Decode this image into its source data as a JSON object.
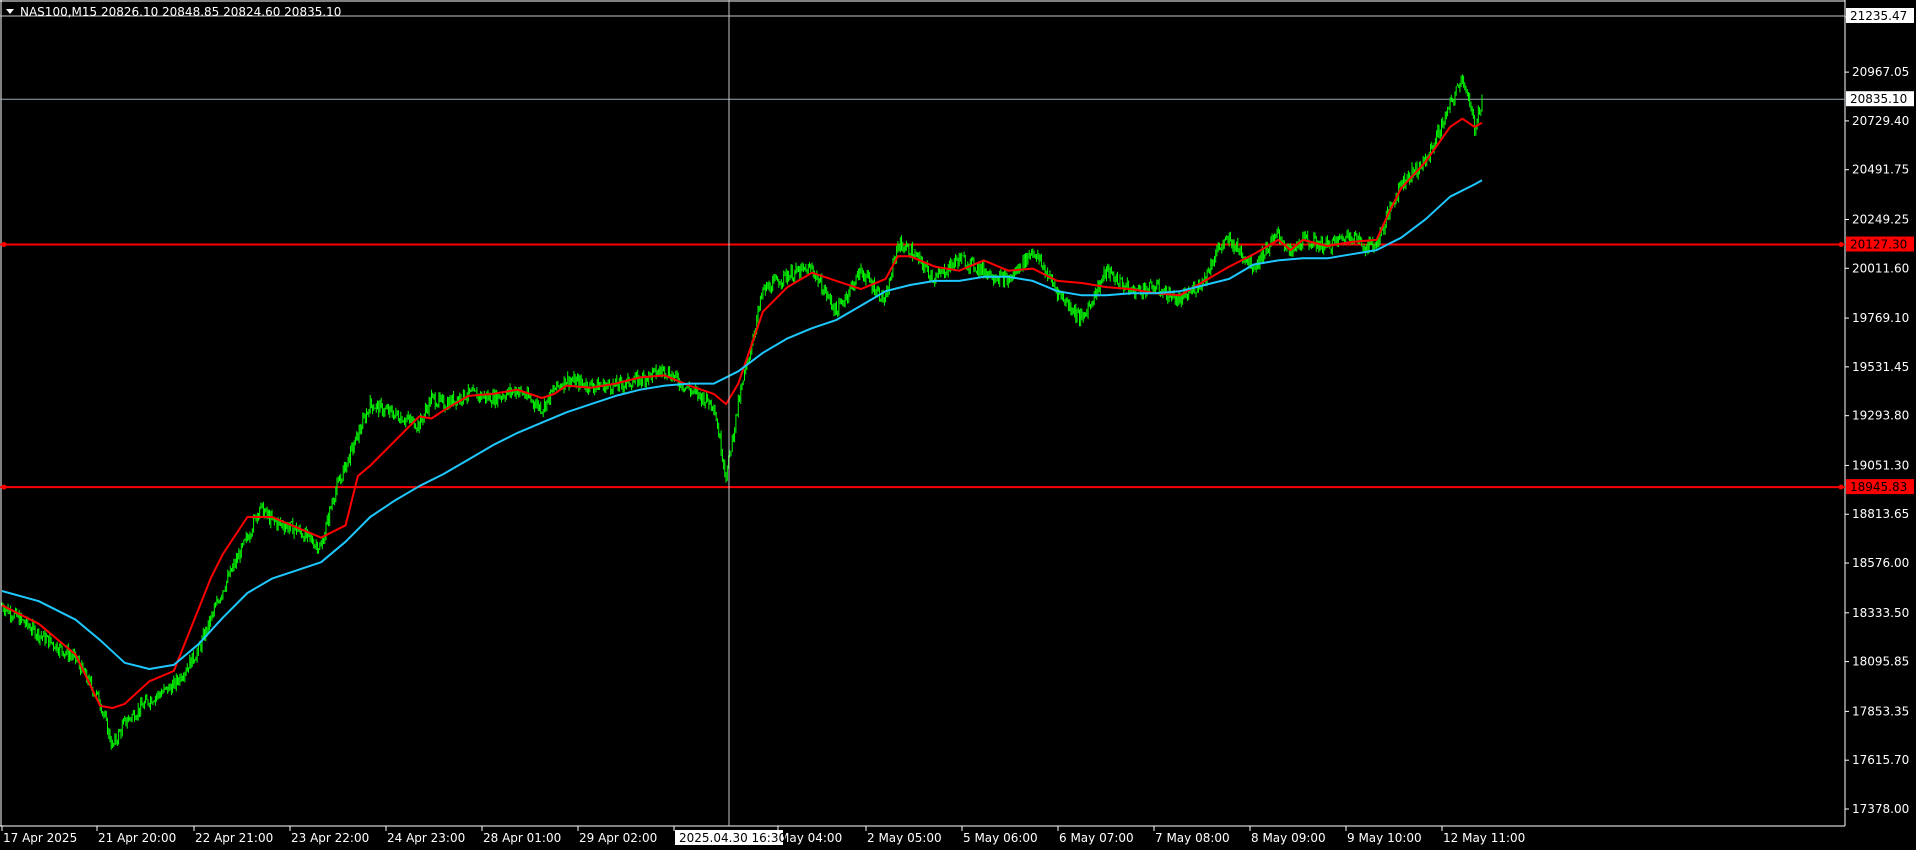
{
  "header": {
    "symbol_line": "NAS100,M15  20826.10 20848.85 20824.60 20835.10"
  },
  "crosshair": {
    "time_label": "2025.04.30 16:30",
    "price_label": "21235.47"
  },
  "current_price": {
    "label": "20835.10",
    "value": 20835.1
  },
  "levels": [
    {
      "label": "20127.30",
      "value": 20127.3,
      "color": "#ff0000"
    },
    {
      "label": "18945.83",
      "value": 18945.83,
      "color": "#ff0000"
    }
  ],
  "colors": {
    "background": "#000000",
    "candles": "#00ff00",
    "fast_ma": "#ff0000",
    "slow_ma": "#1ec8ff",
    "text": "#ffffff",
    "crosshair": "#c8c8c8",
    "bid_line": "#9aa8b4"
  },
  "chart_data": {
    "type": "line",
    "title": "NAS100,M15",
    "ylim": [
      17250,
      21300
    ],
    "y_ticks": [
      "21235.47",
      "20967.05",
      "20729.40",
      "20491.75",
      "20249.25",
      "20011.60",
      "19769.10",
      "19531.45",
      "19293.80",
      "19051.30",
      "18813.65",
      "18576.00",
      "18333.50",
      "18095.85",
      "17853.35",
      "17615.70",
      "17378.00"
    ],
    "x_ticks": [
      "17 Apr 2025",
      "21 Apr 20:00",
      "22 Apr 21:00",
      "23 Apr 22:00",
      "24 Apr 23:00",
      "28 Apr 01:00",
      "29 Apr 02:00",
      "2025.04.30 16:30",
      "May 04:00",
      "2 May 05:00",
      "5 May 06:00",
      "6 May 07:00",
      "7 May 08:00",
      "8 May 09:00",
      "9 May 10:00",
      "12 May 11:00"
    ],
    "series": [
      {
        "type": "candles",
        "x": [
          0,
          30,
          60,
          80,
          90,
          100,
          120,
          140,
          160,
          180,
          200,
          210,
          220,
          240,
          260,
          270,
          290,
          300,
          320,
          340,
          350,
          360,
          380,
          400,
          420,
          440,
          450,
          460,
          480,
          500,
          520,
          540,
          560,
          580,
          590,
          600,
          620,
          640,
          660,
          680,
          700,
          720,
          730,
          740,
          760,
          780,
          800,
          820,
          840,
          860,
          880,
          900,
          920,
          940,
          960,
          980,
          990,
          1000,
          1020,
          1040,
          1050,
          1060,
          1080,
          1100,
          1110,
          1120,
          1140,
          1160,
          1180,
          1190,
          1200,
          1206
        ],
        "y": [
          18370,
          18230,
          18110,
          17900,
          17680,
          17800,
          17910,
          17980,
          18150,
          18450,
          18700,
          18850,
          18780,
          18740,
          18650,
          18900,
          19200,
          19350,
          19300,
          19250,
          19380,
          19350,
          19400,
          19380,
          19420,
          19330,
          19420,
          19470,
          19440,
          19440,
          19470,
          19520,
          19420,
          19350,
          19000,
          19350,
          19900,
          19980,
          20010,
          19800,
          20000,
          19850,
          20130,
          20100,
          19960,
          20060,
          20000,
          19950,
          20100,
          19900,
          19760,
          20000,
          19900,
          19920,
          19850,
          19960,
          20100,
          20150,
          20020,
          20180,
          20080,
          20150,
          20120,
          20180,
          20120,
          20130,
          20430,
          20530,
          20800,
          20950,
          20700,
          20835
        ]
      },
      {
        "name": "",
        "type": "line",
        "x": [
          0,
          30,
          60,
          80,
          90,
          100,
          120,
          140,
          160,
          170,
          180,
          200,
          220,
          240,
          260,
          280,
          290,
          300,
          320,
          340,
          350,
          360,
          380,
          400,
          420,
          440,
          450,
          460,
          480,
          500,
          520,
          540,
          560,
          580,
          590,
          600,
          620,
          640,
          660,
          680,
          700,
          720,
          730,
          740,
          760,
          780,
          800,
          820,
          840,
          860,
          880,
          900,
          920,
          940,
          960,
          980,
          1000,
          1020,
          1040,
          1050,
          1060,
          1080,
          1100,
          1120,
          1130,
          1140,
          1160,
          1180,
          1190,
          1200,
          1206
        ],
        "y": [
          18370,
          18280,
          18130,
          17880,
          17870,
          17890,
          18000,
          18050,
          18350,
          18500,
          18620,
          18800,
          18800,
          18750,
          18700,
          18760,
          19000,
          19050,
          19170,
          19290,
          19280,
          19320,
          19390,
          19400,
          19420,
          19380,
          19400,
          19440,
          19430,
          19450,
          19480,
          19490,
          19440,
          19400,
          19350,
          19450,
          19800,
          19920,
          19990,
          19950,
          19910,
          19960,
          20070,
          20070,
          20020,
          20000,
          20050,
          20000,
          20010,
          19950,
          19940,
          19920,
          19910,
          19890,
          19880,
          19950,
          20020,
          20080,
          20150,
          20100,
          20150,
          20120,
          20140,
          20150,
          20280,
          20400,
          20530,
          20700,
          20740,
          20700,
          20720
        ]
      },
      {
        "name": "",
        "type": "line",
        "x": [
          0,
          30,
          60,
          80,
          100,
          120,
          140,
          160,
          180,
          200,
          220,
          240,
          260,
          280,
          300,
          320,
          340,
          360,
          380,
          400,
          420,
          440,
          460,
          480,
          500,
          520,
          540,
          560,
          580,
          600,
          620,
          640,
          660,
          680,
          700,
          720,
          740,
          760,
          780,
          800,
          820,
          840,
          860,
          880,
          900,
          920,
          940,
          960,
          980,
          1000,
          1020,
          1040,
          1060,
          1080,
          1100,
          1120,
          1140,
          1160,
          1180,
          1200,
          1206
        ],
        "y": [
          18440,
          18390,
          18300,
          18200,
          18090,
          18060,
          18080,
          18180,
          18310,
          18430,
          18500,
          18540,
          18580,
          18680,
          18800,
          18880,
          18950,
          19010,
          19080,
          19150,
          19210,
          19260,
          19310,
          19350,
          19390,
          19420,
          19440,
          19450,
          19450,
          19510,
          19600,
          19670,
          19720,
          19760,
          19830,
          19900,
          19930,
          19950,
          19950,
          19970,
          19970,
          19950,
          19900,
          19880,
          19880,
          19890,
          19890,
          19900,
          19930,
          19960,
          20030,
          20050,
          20060,
          20060,
          20080,
          20100,
          20160,
          20250,
          20360,
          20420,
          20440
        ]
      }
    ]
  }
}
